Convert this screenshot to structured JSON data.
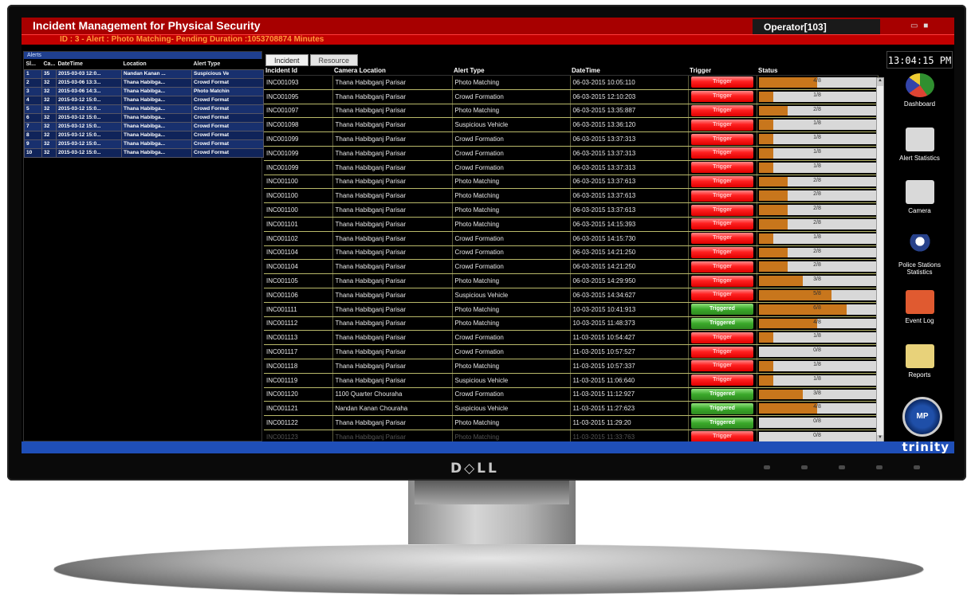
{
  "app": {
    "title": "Incident Management for Physical Security",
    "operator": "Operator[103]",
    "alert_line": "ID : 3 - Alert : Photo Matching- Pending Duration :1053708874 Minutes",
    "brand": "trinity",
    "clock": "13:04:15 PM",
    "window_icons": "▭ ■"
  },
  "monitor": {
    "brand": "D◇LL"
  },
  "alerts": {
    "panel_title": "Alerts",
    "columns": [
      "Sl...",
      "Ca...",
      "DateTime",
      "Location",
      "Alert Type"
    ],
    "rows": [
      [
        "1",
        "35",
        "2015-03-03 12:0...",
        "Nandan Kanan ...",
        "Suspicious Ve"
      ],
      [
        "2",
        "32",
        "2015-03-06 13:3...",
        "Thana Habibga...",
        "Crowd Format"
      ],
      [
        "3",
        "32",
        "2015-03-06 14:3...",
        "Thana Habibga...",
        "Photo Matchin"
      ],
      [
        "4",
        "32",
        "2015-03-12 15:0...",
        "Thana Habibga...",
        "Crowd Format"
      ],
      [
        "5",
        "32",
        "2015-03-12 15:0...",
        "Thana Habibga...",
        "Crowd Format"
      ],
      [
        "6",
        "32",
        "2015-03-12 15:0...",
        "Thana Habibga...",
        "Crowd Format"
      ],
      [
        "7",
        "32",
        "2015-03-12 15:0...",
        "Thana Habibga...",
        "Crowd Format"
      ],
      [
        "8",
        "32",
        "2015-03-12 15:0...",
        "Thana Habibga...",
        "Crowd Format"
      ],
      [
        "9",
        "32",
        "2015-03-12 15:0...",
        "Thana Habibga...",
        "Crowd Format"
      ],
      [
        "10",
        "32",
        "2015-03-12 15:0...",
        "Thana Habibga...",
        "Crowd Format"
      ]
    ]
  },
  "tabs": [
    {
      "label": "Incident",
      "active": true
    },
    {
      "label": "Resource",
      "active": false
    }
  ],
  "grid": {
    "columns": [
      "Incident Id",
      "Camera Location",
      "Alert Type",
      "DateTime",
      "Trigger",
      "Status"
    ],
    "rows": [
      {
        "id": "INC001093",
        "location": "Thana Habibganj Parisar",
        "type": "Photo Matching",
        "datetime": "06-03-2015 10:05:110",
        "trigger": "Trigger",
        "trigger_color": "red",
        "status": "4/8",
        "progress": 0.5
      },
      {
        "id": "INC001095",
        "location": "Thana Habibganj Parisar",
        "type": "Crowd Formation",
        "datetime": "06-03-2015 12:10:203",
        "trigger": "Trigger",
        "trigger_color": "red",
        "status": "1/8",
        "progress": 0.125
      },
      {
        "id": "INC001097",
        "location": "Thana Habibganj Parisar",
        "type": "Photo Matching",
        "datetime": "06-03-2015 13:35:887",
        "trigger": "Trigger",
        "trigger_color": "red",
        "status": "2/8",
        "progress": 0.25
      },
      {
        "id": "INC001098",
        "location": "Thana Habibganj Parisar",
        "type": "Suspicious Vehicle",
        "datetime": "06-03-2015 13:36:120",
        "trigger": "Trigger",
        "trigger_color": "red",
        "status": "1/8",
        "progress": 0.125
      },
      {
        "id": "INC001099",
        "location": "Thana Habibganj Parisar",
        "type": "Crowd Formation",
        "datetime": "06-03-2015 13:37:313",
        "trigger": "Trigger",
        "trigger_color": "red",
        "status": "1/8",
        "progress": 0.125
      },
      {
        "id": "INC001099",
        "location": "Thana Habibganj Parisar",
        "type": "Crowd Formation",
        "datetime": "06-03-2015 13:37:313",
        "trigger": "Trigger",
        "trigger_color": "red",
        "status": "1/8",
        "progress": 0.125
      },
      {
        "id": "INC001099",
        "location": "Thana Habibganj Parisar",
        "type": "Crowd Formation",
        "datetime": "06-03-2015 13:37:313",
        "trigger": "Trigger",
        "trigger_color": "red",
        "status": "1/8",
        "progress": 0.125
      },
      {
        "id": "INC001100",
        "location": "Thana Habibganj Parisar",
        "type": "Photo Matching",
        "datetime": "06-03-2015 13:37:613",
        "trigger": "Trigger",
        "trigger_color": "red",
        "status": "2/8",
        "progress": 0.25
      },
      {
        "id": "INC001100",
        "location": "Thana Habibganj Parisar",
        "type": "Photo Matching",
        "datetime": "06-03-2015 13:37:613",
        "trigger": "Trigger",
        "trigger_color": "red",
        "status": "2/8",
        "progress": 0.25
      },
      {
        "id": "INC001100",
        "location": "Thana Habibganj Parisar",
        "type": "Photo Matching",
        "datetime": "06-03-2015 13:37:613",
        "trigger": "Trigger",
        "trigger_color": "red",
        "status": "2/8",
        "progress": 0.25
      },
      {
        "id": "INC001101",
        "location": "Thana Habibganj Parisar",
        "type": "Photo Matching",
        "datetime": "06-03-2015 14:15:393",
        "trigger": "Trigger",
        "trigger_color": "red",
        "status": "2/8",
        "progress": 0.25
      },
      {
        "id": "INC001102",
        "location": "Thana Habibganj Parisar",
        "type": "Crowd Formation",
        "datetime": "06-03-2015 14:15:730",
        "trigger": "Trigger",
        "trigger_color": "red",
        "status": "1/8",
        "progress": 0.125
      },
      {
        "id": "INC001104",
        "location": "Thana Habibganj Parisar",
        "type": "Crowd Formation",
        "datetime": "06-03-2015 14:21:250",
        "trigger": "Trigger",
        "trigger_color": "red",
        "status": "2/8",
        "progress": 0.25
      },
      {
        "id": "INC001104",
        "location": "Thana Habibganj Parisar",
        "type": "Crowd Formation",
        "datetime": "06-03-2015 14:21:250",
        "trigger": "Trigger",
        "trigger_color": "red",
        "status": "2/8",
        "progress": 0.25
      },
      {
        "id": "INC001105",
        "location": "Thana Habibganj Parisar",
        "type": "Photo Matching",
        "datetime": "06-03-2015 14:29:950",
        "trigger": "Trigger",
        "trigger_color": "red",
        "status": "3/8",
        "progress": 0.375
      },
      {
        "id": "INC001106",
        "location": "Thana Habibganj Parisar",
        "type": "Suspicious Vehicle",
        "datetime": "06-03-2015 14:34:627",
        "trigger": "Trigger",
        "trigger_color": "red",
        "status": "5/8",
        "progress": 0.625
      },
      {
        "id": "INC001111",
        "location": "Thana Habibganj Parisar",
        "type": "Photo Matching",
        "datetime": "10-03-2015 10:41:913",
        "trigger": "Triggered",
        "trigger_color": "green",
        "status": "6/8",
        "progress": 0.75
      },
      {
        "id": "INC001112",
        "location": "Thana Habibganj Parisar",
        "type": "Photo Matching",
        "datetime": "10-03-2015 11:48:373",
        "trigger": "Triggered",
        "trigger_color": "green",
        "status": "4/8",
        "progress": 0.5
      },
      {
        "id": "INC001113",
        "location": "Thana Habibganj Parisar",
        "type": "Crowd Formation",
        "datetime": "11-03-2015 10:54:427",
        "trigger": "Trigger",
        "trigger_color": "red",
        "status": "1/8",
        "progress": 0.125
      },
      {
        "id": "INC001117",
        "location": "Thana Habibganj Parisar",
        "type": "Crowd Formation",
        "datetime": "11-03-2015 10:57:527",
        "trigger": "Trigger",
        "trigger_color": "red",
        "status": "0/8",
        "progress": 0
      },
      {
        "id": "INC001118",
        "location": "Thana Habibganj Parisar",
        "type": "Photo Matching",
        "datetime": "11-03-2015 10:57:337",
        "trigger": "Trigger",
        "trigger_color": "red",
        "status": "1/8",
        "progress": 0.125
      },
      {
        "id": "INC001119",
        "location": "Thana Habibganj Parisar",
        "type": "Suspicious Vehicle",
        "datetime": "11-03-2015 11:06:640",
        "trigger": "Trigger",
        "trigger_color": "red",
        "status": "1/8",
        "progress": 0.125
      },
      {
        "id": "INC001120",
        "location": "1100 Quarter Chouraha",
        "type": "Crowd Formation",
        "datetime": "11-03-2015 11:12:927",
        "trigger": "Triggered",
        "trigger_color": "green",
        "status": "3/8",
        "progress": 0.375
      },
      {
        "id": "INC001121",
        "location": "Nandan Kanan Chouraha",
        "type": "Suspicious Vehicle",
        "datetime": "11-03-2015 11:27:623",
        "trigger": "Triggered",
        "trigger_color": "green",
        "status": "4/8",
        "progress": 0.5
      },
      {
        "id": "INC001122",
        "location": "Thana Habibganj Parisar",
        "type": "Photo Matching",
        "datetime": "11-03-2015 11:29:20",
        "trigger": "Triggered",
        "trigger_color": "green",
        "status": "0/8",
        "progress": 0
      },
      {
        "id": "INC001123",
        "location": "Thana Habibganj Parisar",
        "type": "Photo Matching",
        "datetime": "11-03-2015 11:33:763",
        "trigger": "Trigger",
        "trigger_color": "red",
        "status": "0/8",
        "progress": 0,
        "faded": true
      }
    ]
  },
  "nav": [
    {
      "label": "Dashboard",
      "icon": "pie-chart-icon",
      "color": "#2f8f2f"
    },
    {
      "label": "Alert Statistics",
      "icon": "statistics-icon",
      "color": "#d9d9d9"
    },
    {
      "label": "Camera",
      "icon": "camera-icon",
      "color": "#d9d9d9"
    },
    {
      "label": "Police Stations Statistics",
      "icon": "police-officer-icon",
      "color": "#000000"
    },
    {
      "label": "Event Log",
      "icon": "magnifier-icon",
      "color": "#e05a30"
    },
    {
      "label": "Reports",
      "icon": "notepad-icon",
      "color": "#e8d27a"
    }
  ],
  "colors": {
    "title_bar": "#a70000",
    "alert_text": "#ff9a3a",
    "trigger_red": "#ff2020",
    "trigger_green": "#3aa82a",
    "status_fill": "#c8761c",
    "bottom_bar": "#1f4fb8"
  }
}
